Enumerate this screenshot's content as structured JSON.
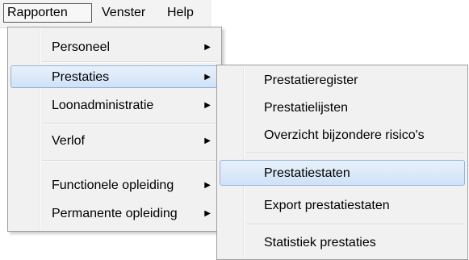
{
  "menubar": {
    "items": [
      {
        "label": "Rapporten"
      },
      {
        "label": "Venster"
      },
      {
        "label": "Help"
      }
    ]
  },
  "rapporten_menu": {
    "items": [
      {
        "label": "Personeel",
        "arrow": "▶"
      },
      {
        "label": "Prestaties",
        "arrow": "▶"
      },
      {
        "label": "Loonadministratie",
        "arrow": "▶"
      },
      {
        "label": "Verlof",
        "arrow": "▶"
      },
      {
        "label": "Functionele opleiding",
        "arrow": "▶"
      },
      {
        "label": "Permanente opleiding",
        "arrow": "▶"
      }
    ],
    "highlighted": "Prestaties"
  },
  "prestaties_submenu": {
    "items": [
      {
        "label": "Prestatieregister"
      },
      {
        "label": "Prestatielijsten"
      },
      {
        "label": "Overzicht bijzondere risico's"
      },
      {
        "label": "Prestatiestaten"
      },
      {
        "label": "Export prestatiestaten"
      },
      {
        "label": "Statistiek prestaties"
      }
    ],
    "highlighted": "Prestatiestaten"
  },
  "colors": {
    "highlight_fill": "#d6e6f8",
    "highlight_border": "#8fb3e0",
    "menu_background": "#f1f1f1"
  }
}
